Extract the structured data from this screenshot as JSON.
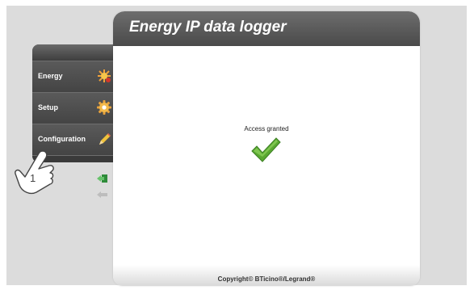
{
  "header": {
    "title": "Energy IP data logger"
  },
  "sidebar": {
    "items": [
      {
        "label": "Energy",
        "icon": "energy-sparkle-icon"
      },
      {
        "label": "Setup",
        "icon": "gear-icon"
      },
      {
        "label": "Configuration",
        "icon": "pencil-icon"
      }
    ]
  },
  "actions": {
    "exit_icon": "exit-door-icon",
    "back_icon": "back-arrow-icon"
  },
  "main": {
    "status_text": "Access granted",
    "status_icon": "checkmark-icon"
  },
  "footer": {
    "copyright": "Copyright© BTicino®/Legrand®"
  },
  "overlay": {
    "step_number": "1",
    "cursor_icon": "hand-pointer-icon"
  },
  "colors": {
    "header": "#555555",
    "accent_check": "#5aa832",
    "exit_green": "#3a9a3a"
  }
}
